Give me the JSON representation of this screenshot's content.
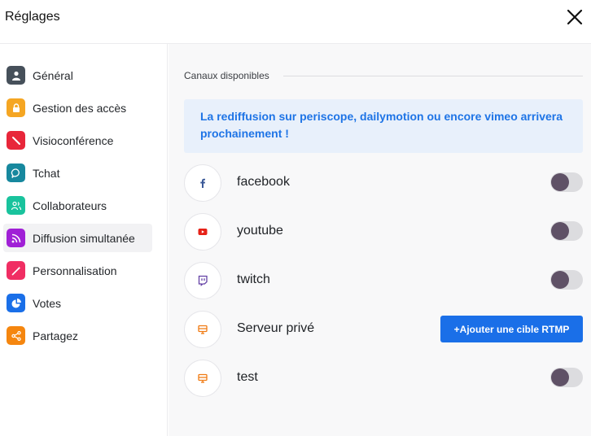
{
  "header": {
    "title": "Réglages"
  },
  "sidebar": {
    "items": [
      {
        "label": "Général",
        "color": "#46505a"
      },
      {
        "label": "Gestion des accès",
        "color": "#f5a623"
      },
      {
        "label": "Visioconférence",
        "color": "#e8263a"
      },
      {
        "label": "Tchat",
        "color": "#17889e"
      },
      {
        "label": "Collaborateurs",
        "color": "#19c39d"
      },
      {
        "label": "Diffusion simultanée",
        "color": "#a020d6",
        "active": true
      },
      {
        "label": "Personnalisation",
        "color": "#f02e63"
      },
      {
        "label": "Votes",
        "color": "#1a6fe8"
      },
      {
        "label": "Partagez",
        "color": "#f5860f"
      }
    ]
  },
  "main": {
    "section_title": "Canaux disponibles",
    "notice": "La rediffusion sur periscope, dailymotion ou encore vimeo arrivera prochainement !",
    "channels": [
      {
        "name": "facebook",
        "icon": "facebook-icon",
        "enabled": false
      },
      {
        "name": "youtube",
        "icon": "youtube-icon",
        "enabled": false
      },
      {
        "name": "twitch",
        "icon": "twitch-icon",
        "enabled": false
      },
      {
        "name": "Serveur privé",
        "icon": "server-icon",
        "button_label": "+Ajouter une cible RTMP"
      },
      {
        "name": "test",
        "icon": "server-icon",
        "enabled": false
      }
    ]
  },
  "colors": {
    "accent": "#1a6fe8",
    "notice_bg": "#e8f0fb",
    "toggle_knob": "#5f5166",
    "facebook": "#3b5998",
    "youtube": "#e62117",
    "twitch": "#6441a5",
    "server": "#f07a12"
  }
}
